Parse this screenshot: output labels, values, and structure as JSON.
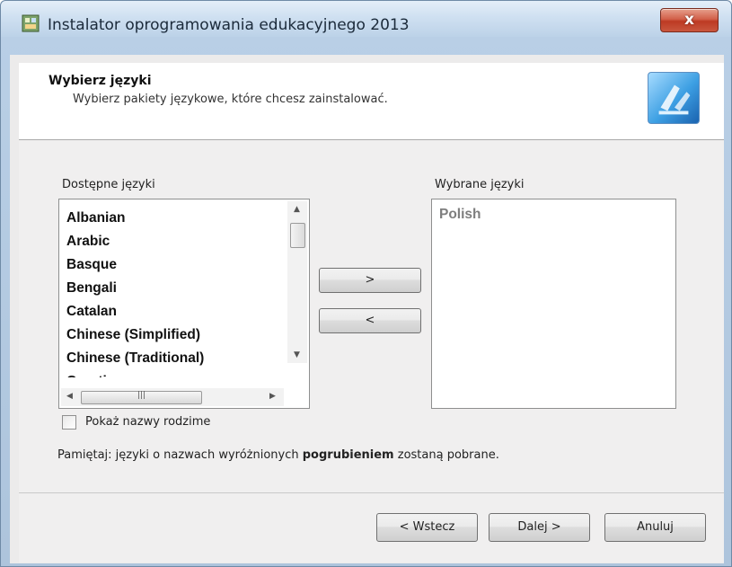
{
  "window": {
    "title": "Instalator oprogramowania edukacyjnego 2013",
    "close_label": "x"
  },
  "header": {
    "title": "Wybierz języki",
    "subtitle": "Wybierz pakiety językowe, które chcesz zainstalować."
  },
  "available": {
    "label": "Dostępne języki",
    "items": [
      "Albanian",
      "Arabic",
      "Basque",
      "Bengali",
      "Catalan",
      "Chinese (Simplified)",
      "Chinese (Traditional)",
      "Croatian"
    ]
  },
  "selected": {
    "label": "Wybrane języki",
    "items": [
      "Polish"
    ]
  },
  "transfer": {
    "add_label": ">",
    "remove_label": "<"
  },
  "options": {
    "native_names_label": "Pokaż nazwy rodzime",
    "native_names_checked": false
  },
  "note": {
    "prefix": "Pamiętaj: języki o nazwach wyróżnionych ",
    "bold": "pogrubieniem",
    "suffix": " zostaną pobrane."
  },
  "footer": {
    "back_label": "< Wstecz",
    "next_label": "Dalej >",
    "cancel_label": "Anuluj"
  }
}
